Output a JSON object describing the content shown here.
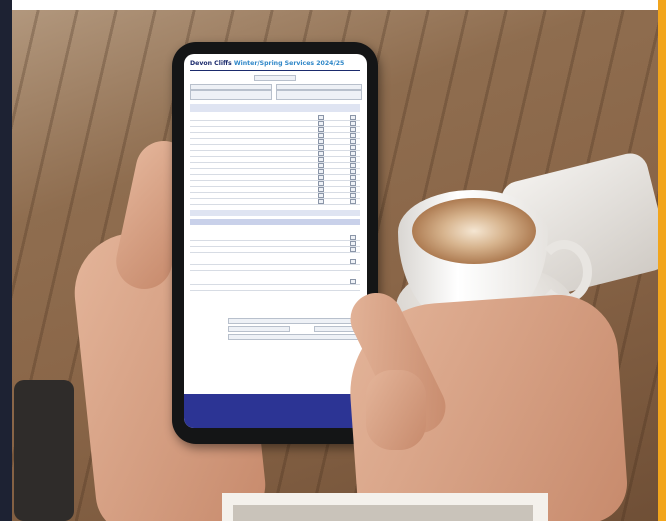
{
  "form": {
    "title_brand": "Devon Cliffs",
    "title_rest": "Winter/Spring Services 2024/25"
  },
  "colors": {
    "form_navy": "#1a2a6c",
    "form_accent": "#2f87c8",
    "footer_bar": "#2c3494",
    "orange_strip": "#f2a51c"
  }
}
